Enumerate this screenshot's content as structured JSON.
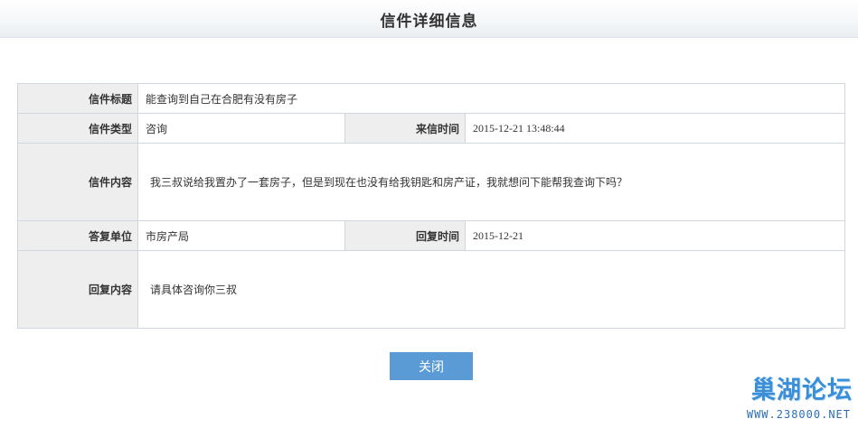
{
  "header": {
    "title": "信件详细信息"
  },
  "letter": {
    "subject_label": "信件标题",
    "subject_value": "能查询到自己在合肥有没有房子",
    "type_label": "信件类型",
    "type_value": "咨询",
    "received_time_label": "来信时间",
    "received_time_value": "2015-12-21 13:48:44",
    "content_label": "信件内容",
    "content_value": "我三叔说给我置办了一套房子，但是到现在也没有给我钥匙和房产证，我就想问下能帮我查询下吗？",
    "reply_unit_label": "答复单位",
    "reply_unit_value": "市房产局",
    "reply_time_label": "回复时间",
    "reply_time_value": "2015-12-21",
    "reply_content_label": "回复内容",
    "reply_content_value": "请具体咨询你三叔"
  },
  "actions": {
    "close_label": "关闭"
  },
  "watermark": {
    "logo_text": "巢湖论坛",
    "url_text": "WWW.238000.NET"
  }
}
